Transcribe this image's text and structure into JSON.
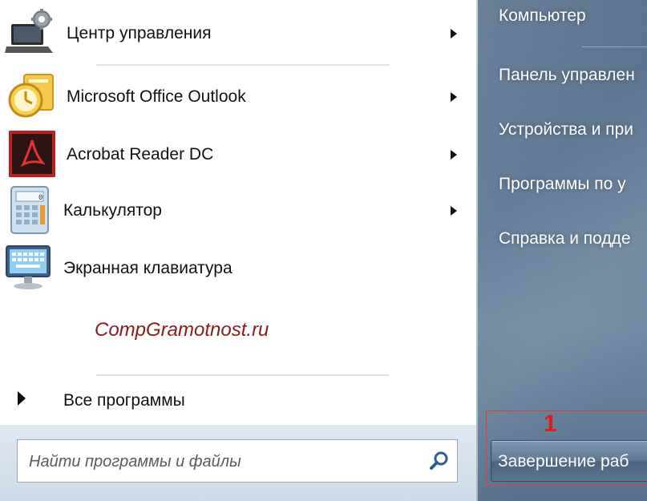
{
  "programs": [
    {
      "label": "Центр управления",
      "icon": "laptop-gear-icon",
      "has_submenu": true
    },
    {
      "label": "Microsoft Office Outlook",
      "icon": "outlook-clock-icon",
      "has_submenu": true
    },
    {
      "label": "Acrobat Reader DC",
      "icon": "acrobat-icon",
      "has_submenu": true
    },
    {
      "label": "Калькулятор",
      "icon": "calculator-icon",
      "has_submenu": true
    },
    {
      "label": "Экранная клавиатура",
      "icon": "onscreen-keyboard-icon",
      "has_submenu": false
    }
  ],
  "watermark": "CompGramotnost.ru",
  "all_programs": "Все программы",
  "search": {
    "placeholder": "Найти программы и файлы",
    "value": ""
  },
  "right_menu": [
    {
      "label": "Компьютер"
    },
    {
      "label": "Панель управлен"
    },
    {
      "label": "Устройства и при"
    },
    {
      "label": "Программы по у"
    },
    {
      "label": "Справка и подде"
    }
  ],
  "annotation_number": "1",
  "shutdown": {
    "label": "Завершение раб"
  },
  "colors": {
    "right_pane": "#627c96",
    "annotation": "#e01b1b",
    "watermark": "#8b1a1a",
    "bottom_band": "#d8e4ef"
  }
}
